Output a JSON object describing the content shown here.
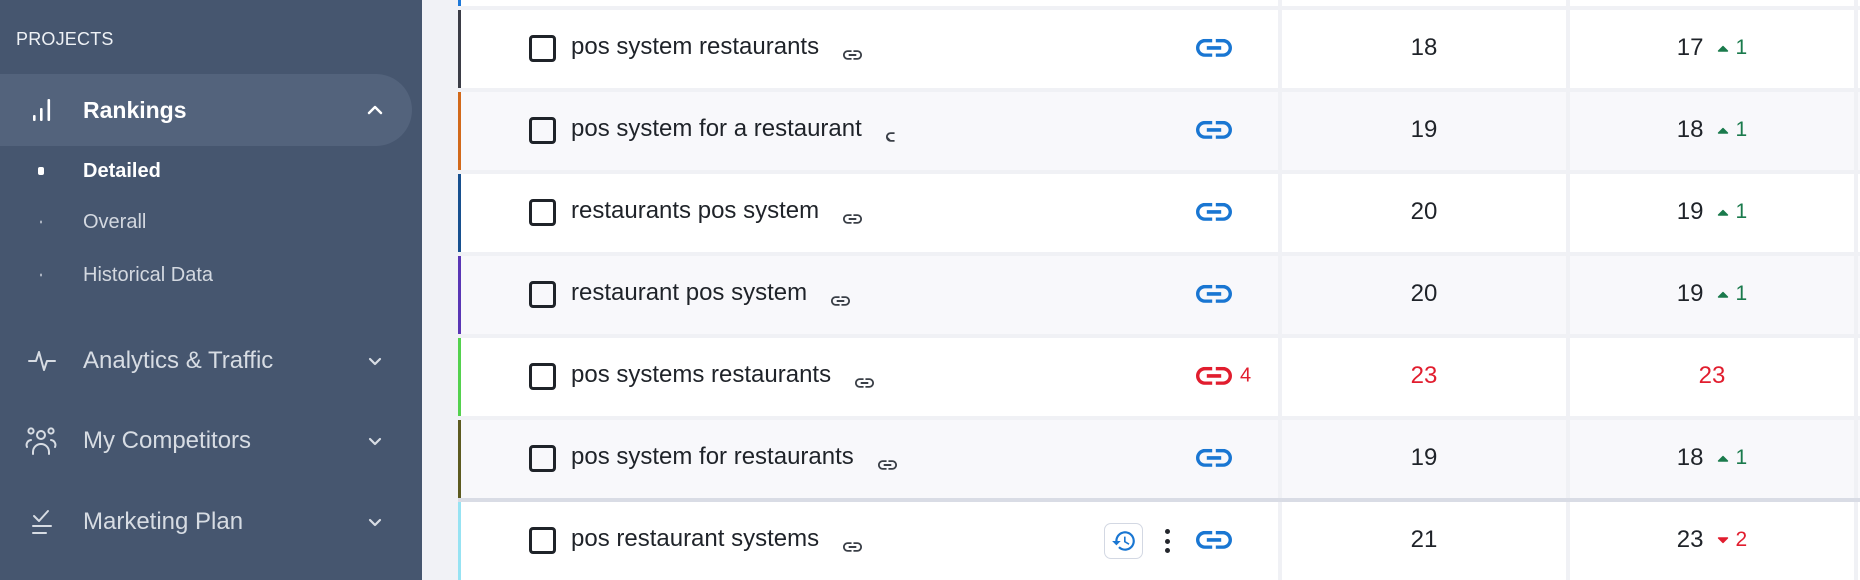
{
  "colors": {
    "accent": "#1976d2",
    "positive": "#1a7a4c",
    "negative": "#e11d2e",
    "sidebar_bg": "#46566f",
    "sidebar_active_bg": "#53637c"
  },
  "sidebar": {
    "section_label": "PROJECTS",
    "nav": {
      "rankings": {
        "label": "Rankings",
        "icon": "bar-chart-icon",
        "expanded": true,
        "active": true,
        "sub_items": [
          {
            "label": "Detailed",
            "active": true
          },
          {
            "label": "Overall",
            "active": false
          },
          {
            "label": "Historical Data",
            "active": false
          }
        ]
      },
      "analytics": {
        "label": "Analytics & Traffic",
        "icon": "activity-icon",
        "expanded": false
      },
      "competitors": {
        "label": "My Competitors",
        "icon": "users-icon",
        "expanded": false
      },
      "marketing": {
        "label": "Marketing Plan",
        "icon": "checklist-icon",
        "expanded": false
      }
    }
  },
  "table": {
    "partial_row": {
      "color": "#1e78d8"
    },
    "rows": [
      {
        "keyword": "pos system restaurants",
        "color": "#3b3d46",
        "link_status": "ok",
        "link_count": "",
        "position_1": "18",
        "position_2": "17",
        "change_direction": "up",
        "change_value": "1",
        "alert": false,
        "hovered": false
      },
      {
        "keyword": "pos system for a restaurant",
        "color": "#d2691a",
        "link_status": "ok",
        "link_count": "",
        "position_1": "19",
        "position_2": "18",
        "change_direction": "up",
        "change_value": "1",
        "alert": false,
        "hovered": false
      },
      {
        "keyword": "restaurants pos system",
        "color": "#17508f",
        "link_status": "ok",
        "link_count": "",
        "position_1": "20",
        "position_2": "19",
        "change_direction": "up",
        "change_value": "1",
        "alert": false,
        "hovered": false
      },
      {
        "keyword": "restaurant pos system",
        "color": "#5a36b5",
        "link_status": "ok",
        "link_count": "",
        "position_1": "20",
        "position_2": "19",
        "change_direction": "up",
        "change_value": "1",
        "alert": false,
        "hovered": false
      },
      {
        "keyword": "pos systems restaurants",
        "color": "#54d14e",
        "link_status": "broken",
        "link_count": "4",
        "position_1": "23",
        "position_2": "23",
        "change_direction": "none",
        "change_value": "",
        "alert": true,
        "hovered": false
      },
      {
        "keyword": "pos system for restaurants",
        "color": "#5c5a20",
        "link_status": "ok",
        "link_count": "",
        "position_1": "19",
        "position_2": "18",
        "change_direction": "up",
        "change_value": "1",
        "alert": false,
        "hovered": false
      },
      {
        "keyword": "pos restaurant systems",
        "color": "#97e3f3",
        "link_status": "ok",
        "link_count": "",
        "position_1": "21",
        "position_2": "23",
        "change_direction": "down",
        "change_value": "2",
        "alert": false,
        "hovered": true
      }
    ]
  }
}
